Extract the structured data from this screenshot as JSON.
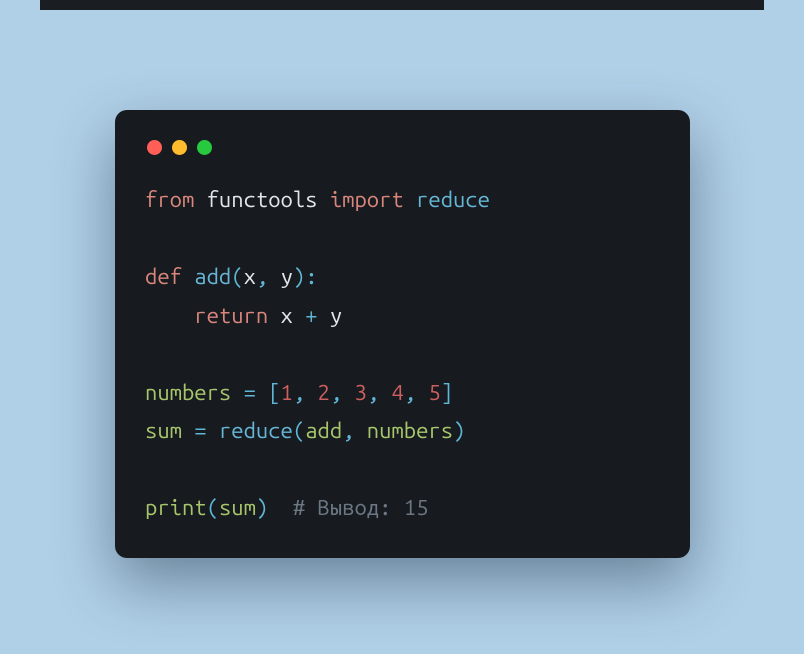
{
  "code": {
    "line1": {
      "kw1": "from",
      "mod": "functools",
      "kw2": "import",
      "fn": "reduce"
    },
    "line3": {
      "kw": "def",
      "fn": "add",
      "lp": "(",
      "p1": "x",
      "c1": ", ",
      "p2": "y",
      "rp": ")",
      "colon": ":"
    },
    "line4": {
      "indent": "    ",
      "kw": "return",
      "p1": "x",
      "op": " + ",
      "p2": "y"
    },
    "line6": {
      "var": "numbers",
      "eq": " = ",
      "lb": "[",
      "n1": "1",
      "c1": ", ",
      "n2": "2",
      "c2": ", ",
      "n3": "3",
      "c3": ", ",
      "n4": "4",
      "c4": ", ",
      "n5": "5",
      "rb": "]"
    },
    "line7": {
      "var": "sum",
      "eq": " = ",
      "fn": "reduce",
      "lp": "(",
      "a1": "add",
      "c1": ", ",
      "a2": "numbers",
      "rp": ")"
    },
    "line9": {
      "fn": "print",
      "lp": "(",
      "arg": "sum",
      "rp": ")",
      "sp": "  ",
      "cmt": "# Вывод: 15"
    }
  }
}
